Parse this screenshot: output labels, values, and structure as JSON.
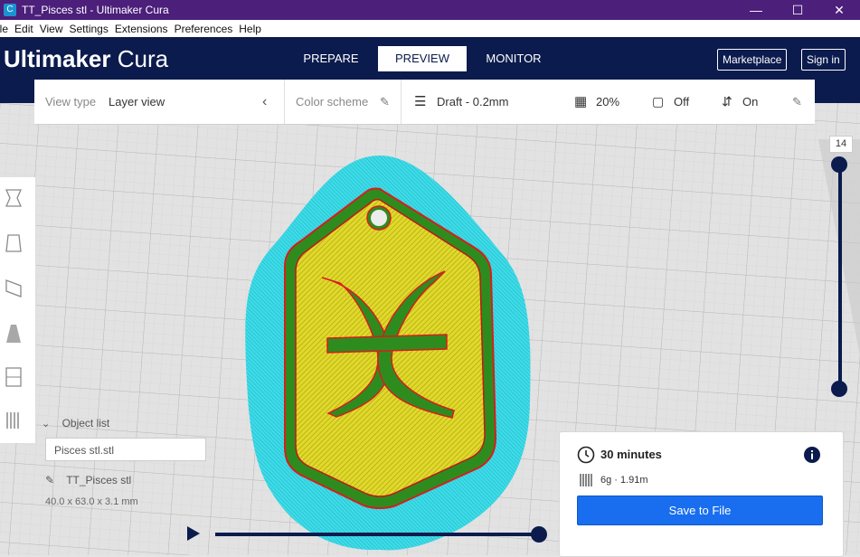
{
  "window": {
    "title": "TT_Pisces stl - Ultimaker Cura",
    "app_icon": "C"
  },
  "menu": [
    "ile",
    "Edit",
    "View",
    "Settings",
    "Extensions",
    "Preferences",
    "Help"
  ],
  "header": {
    "brand_primary": "Ultimaker",
    "brand_secondary": "Cura",
    "tabs": [
      "PREPARE",
      "PREVIEW",
      "MONITOR"
    ],
    "active_tab": "PREVIEW",
    "marketplace_label": "Marketplace",
    "signin_label": "Sign in"
  },
  "toolbar": {
    "view_type_label": "View type",
    "view_type_value": "Layer view",
    "color_scheme_label": "Color scheme",
    "profile": "Draft - 0.2mm",
    "infill": "20%",
    "support": "Off",
    "adhesion": "On"
  },
  "layer": {
    "current": "14"
  },
  "object_panel": {
    "header": "Object list",
    "list_item": "Pisces stl.stl",
    "object_name": "TT_Pisces stl",
    "dimensions": "40.0 x 63.0 x 3.1 mm"
  },
  "print_panel": {
    "time": "30 minutes",
    "material": "6g · 1.91m",
    "save_label": "Save to File"
  },
  "colors": {
    "header": "#0b1b4d",
    "title_bar": "#4b1f7a",
    "accent": "#196ef0",
    "skirt": "#3ddce8",
    "infill": "#d8d21a",
    "wall": "#2e8c1e",
    "outer_wall": "#d81d1d"
  },
  "icons": {
    "collapse": "chevron-left-icon",
    "edit": "pencil-icon",
    "info": "info-icon",
    "clock": "clock-icon"
  }
}
